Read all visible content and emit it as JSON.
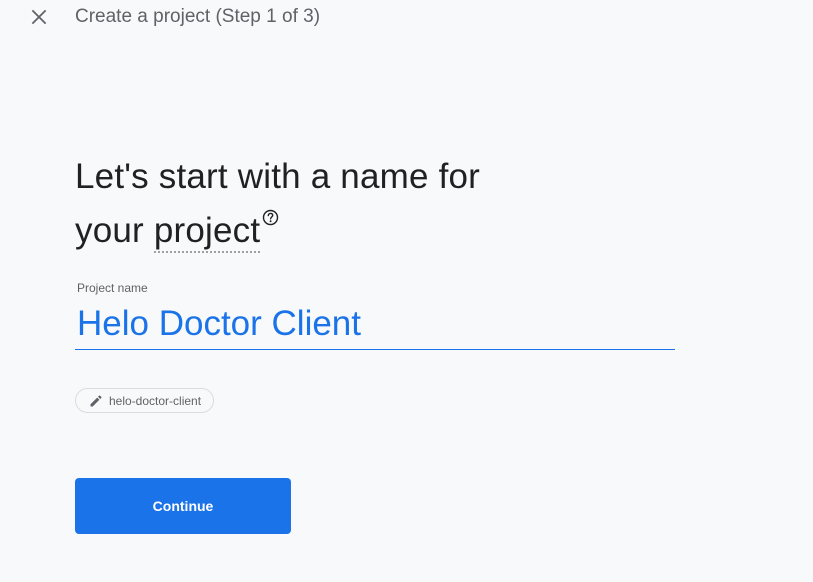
{
  "header": {
    "step_title": "Create a project (Step 1 of 3)",
    "close_icon": "close-icon"
  },
  "main": {
    "heading_line1": "Let's start with a name for",
    "heading_line2_prefix": "your ",
    "heading_line2_term": "project",
    "help_icon": "help-circle-icon"
  },
  "form": {
    "project_name_label": "Project name",
    "project_name_value": "Helo Doctor Client",
    "project_id": "helo-doctor-client",
    "edit_icon": "pencil-icon"
  },
  "actions": {
    "continue_label": "Continue"
  },
  "colors": {
    "accent": "#1a73e8",
    "background": "#f8f9fa",
    "text_primary": "#202124",
    "text_secondary": "#5f6368"
  }
}
